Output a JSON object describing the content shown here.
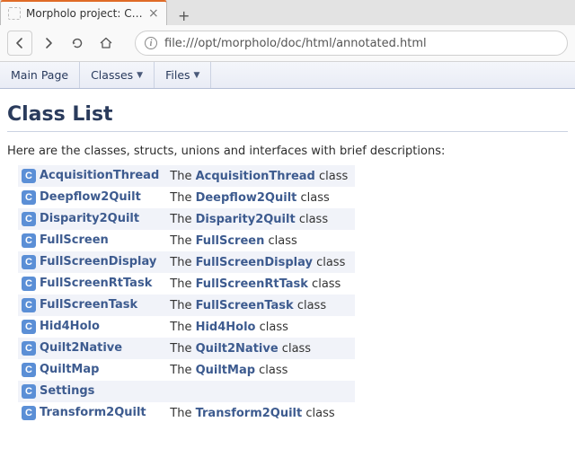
{
  "browser": {
    "tab_title": "Morpholo project: Class Lis",
    "url": "file:///opt/morpholo/doc/html/annotated.html",
    "info_glyph": "i"
  },
  "nav_tabs": {
    "main_page": "Main Page",
    "classes": "Classes",
    "files": "Files"
  },
  "page": {
    "title": "Class List",
    "intro": "Here are the classes, structs, unions and interfaces with brief descriptions:"
  },
  "classes": [
    {
      "name": "AcquisitionThread",
      "desc_prefix": "The ",
      "desc_link": "AcquisitionThread",
      "desc_suffix": " class"
    },
    {
      "name": "Deepflow2Quilt",
      "desc_prefix": "The ",
      "desc_link": "Deepflow2Quilt",
      "desc_suffix": " class"
    },
    {
      "name": "Disparity2Quilt",
      "desc_prefix": "The ",
      "desc_link": "Disparity2Quilt",
      "desc_suffix": " class"
    },
    {
      "name": "FullScreen",
      "desc_prefix": "The ",
      "desc_link": "FullScreen",
      "desc_suffix": " class"
    },
    {
      "name": "FullScreenDisplay",
      "desc_prefix": "The ",
      "desc_link": "FullScreenDisplay",
      "desc_suffix": " class"
    },
    {
      "name": "FullScreenRtTask",
      "desc_prefix": "The ",
      "desc_link": "FullScreenRtTask",
      "desc_suffix": " class"
    },
    {
      "name": "FullScreenTask",
      "desc_prefix": "The ",
      "desc_link": "FullScreenTask",
      "desc_suffix": " class"
    },
    {
      "name": "Hid4Holo",
      "desc_prefix": "The ",
      "desc_link": "Hid4Holo",
      "desc_suffix": " class"
    },
    {
      "name": "Quilt2Native",
      "desc_prefix": "The ",
      "desc_link": "Quilt2Native",
      "desc_suffix": " class"
    },
    {
      "name": "QuiltMap",
      "desc_prefix": "The ",
      "desc_link": "QuiltMap",
      "desc_suffix": " class"
    },
    {
      "name": "Settings",
      "desc_prefix": "",
      "desc_link": "",
      "desc_suffix": ""
    },
    {
      "name": "Transform2Quilt",
      "desc_prefix": "The ",
      "desc_link": "Transform2Quilt",
      "desc_suffix": " class"
    }
  ]
}
